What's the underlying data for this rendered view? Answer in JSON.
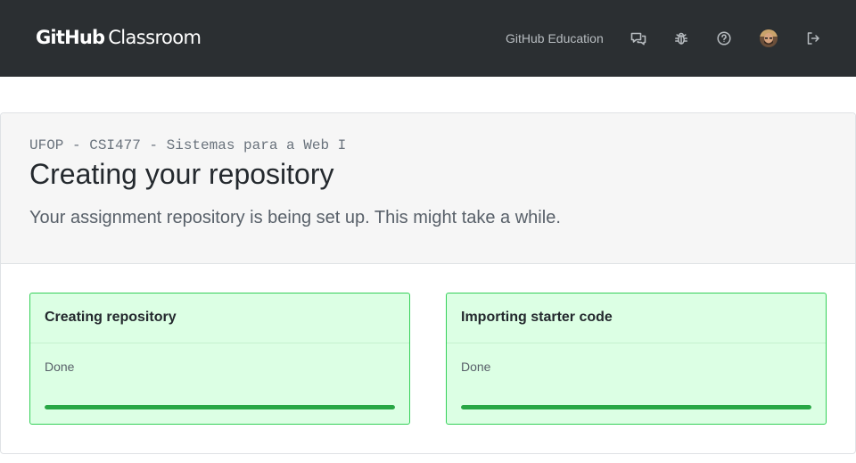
{
  "header": {
    "brand_strong": "GitHub",
    "brand_light": "Classroom",
    "education_link": "GitHub Education",
    "icons": [
      "feedback-icon",
      "bug-icon",
      "help-icon",
      "avatar",
      "sign-out-icon"
    ]
  },
  "main": {
    "course": "UFOP - CSI477 - Sistemas para a Web I",
    "title": "Creating your repository",
    "lead": "Your assignment repository is being set up. This might take a while."
  },
  "steps": [
    {
      "title": "Creating repository",
      "status": "Done",
      "progress": 1.0
    },
    {
      "title": "Importing starter code",
      "status": "Done",
      "progress": 1.0
    }
  ],
  "colors": {
    "header_bg": "#2b2f32",
    "card_bg": "#dcffe4",
    "card_border": "#34d058",
    "progress": "#28a745"
  }
}
